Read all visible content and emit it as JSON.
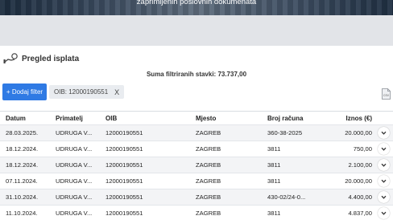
{
  "hero": {
    "caption": "zaprimljenih poslovnih dokumenata"
  },
  "page": {
    "title": "Pregled isplata",
    "title_icon": "hand-money-icon"
  },
  "summary": {
    "text": "Suma filtriranih stavki: 73.737,00"
  },
  "filters": {
    "add_label": "+ Dodaj filter",
    "chip_label": "OIB: 12000190551",
    "chip_remove": "X"
  },
  "export": {
    "icon": "csv-file-icon",
    "label": "CSV"
  },
  "table": {
    "columns": [
      "Datum",
      "Primatelj",
      "OIB",
      "Mjesto",
      "Broj računa",
      "Iznos (€)"
    ],
    "rows": [
      [
        "28.03.2025.",
        "UDRUGA V...",
        "12000190551",
        "ZAGREB",
        "360-38-2025",
        "20.000,00"
      ],
      [
        "18.12.2024.",
        "UDRUGA V...",
        "12000190551",
        "ZAGREB",
        "3811",
        "750,00"
      ],
      [
        "18.12.2024.",
        "UDRUGA V...",
        "12000190551",
        "ZAGREB",
        "3811",
        "2.100,00"
      ],
      [
        "07.11.2024.",
        "UDRUGA V...",
        "12000190551",
        "ZAGREB",
        "3811",
        "20.000,00"
      ],
      [
        "31.10.2024.",
        "UDRUGA V...",
        "12000190551",
        "ZAGREB",
        "430-02/24-0...",
        "4.400,00"
      ],
      [
        "11.10.2024.",
        "UDRUGA V...",
        "12000190551",
        "ZAGREB",
        "3811",
        "4.837,00"
      ]
    ]
  },
  "colors": {
    "accent": "#2f7ae4"
  }
}
